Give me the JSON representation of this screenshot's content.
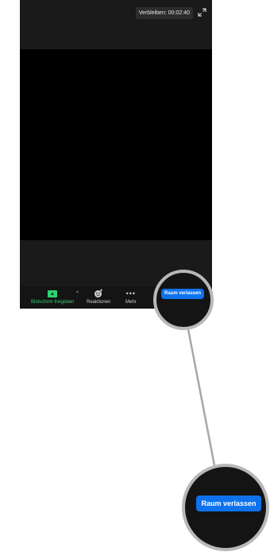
{
  "meeting": {
    "timer_text": "Verbleiben: 00:02:40"
  },
  "toolbar": {
    "share_label": "Bildschirm freigeben",
    "reactions_label": "Reaktionen",
    "more_label": "Mehr"
  },
  "callout": {
    "leave_label_small": "Raum verlassen",
    "leave_label_large": "Raum verlassen"
  },
  "colors": {
    "leave_button": "#0e72ed",
    "share_green": "#2dd36f",
    "background_dark": "#1a1a1a",
    "magnifier_ring": "#b8b8b8"
  },
  "icons": [
    "expand-icon",
    "share-screen-icon",
    "reactions-icon",
    "more-dots-icon",
    "caret-up-icon"
  ]
}
